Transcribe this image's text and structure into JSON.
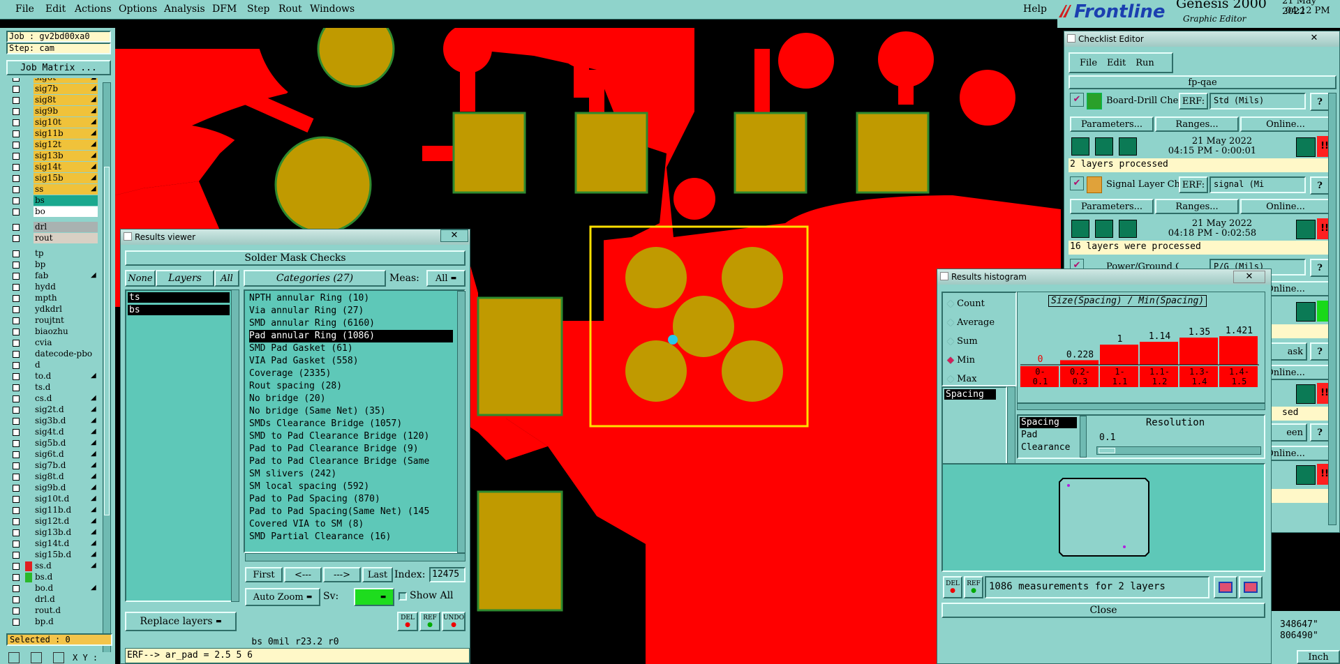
{
  "menubar": {
    "items": [
      "File",
      "Edit",
      "Actions",
      "Options",
      "Analysis",
      "DFM",
      "Step",
      "Rout",
      "Windows"
    ],
    "help": "Help"
  },
  "brand": {
    "logo": "Frontline",
    "product": "Genesis 2000",
    "subtitle": "Graphic Editor",
    "date": "21 May 2022",
    "time": "04:12 PM"
  },
  "job": {
    "job_label": "Job : gv2bd00xa0",
    "step_label": "Step: cam",
    "job_matrix": "Job Matrix ..."
  },
  "layers": [
    {
      "name": "sig6t",
      "color": "#f0c23a",
      "arrow": true
    },
    {
      "name": "sig7b",
      "color": "#f0c23a",
      "arrow": true
    },
    {
      "name": "sig8t",
      "color": "#f0c23a",
      "arrow": true
    },
    {
      "name": "sig9b",
      "color": "#f0c23a",
      "arrow": true
    },
    {
      "name": "sig10t",
      "color": "#f0c23a",
      "arrow": true
    },
    {
      "name": "sig11b",
      "color": "#f0c23a",
      "arrow": true
    },
    {
      "name": "sig12t",
      "color": "#f0c23a",
      "arrow": true
    },
    {
      "name": "sig13b",
      "color": "#f0c23a",
      "arrow": true
    },
    {
      "name": "sig14t",
      "color": "#f0c23a",
      "arrow": true
    },
    {
      "name": "sig15b",
      "color": "#f0c23a",
      "arrow": true
    },
    {
      "name": "ss",
      "color": "#f0c23a",
      "arrow": true
    },
    {
      "name": "bs",
      "color": "#1aa88e",
      "arrow": false
    },
    {
      "name": "bo",
      "color": "#ffffff",
      "arrow": false
    },
    {
      "name": "drl",
      "color": "#a9b2b1",
      "arrow": false
    },
    {
      "name": "rout",
      "color": "#d8d0c4",
      "arrow": false
    },
    {
      "name": "tp",
      "color": "#8fd3cb",
      "arrow": false
    },
    {
      "name": "bp",
      "color": "#8fd3cb",
      "arrow": false
    },
    {
      "name": "fab",
      "color": "#8fd3cb",
      "arrow": true
    },
    {
      "name": "hydd",
      "color": "#8fd3cb",
      "arrow": false
    },
    {
      "name": "mpth",
      "color": "#8fd3cb",
      "arrow": false
    },
    {
      "name": "ydkdrl",
      "color": "#8fd3cb",
      "arrow": false
    },
    {
      "name": "roujtnt",
      "color": "#8fd3cb",
      "arrow": false
    },
    {
      "name": "biaozhu",
      "color": "#8fd3cb",
      "arrow": false
    },
    {
      "name": "cvia",
      "color": "#8fd3cb",
      "arrow": false
    },
    {
      "name": "datecode-pbo",
      "color": "#8fd3cb",
      "arrow": false
    },
    {
      "name": "d",
      "color": "#8fd3cb",
      "arrow": false
    },
    {
      "name": "to.d",
      "color": "#8fd3cb",
      "arrow": true
    },
    {
      "name": "ts.d",
      "color": "#8fd3cb",
      "arrow": false
    },
    {
      "name": "cs.d",
      "color": "#8fd3cb",
      "arrow": true
    },
    {
      "name": "sig2t.d",
      "color": "#8fd3cb",
      "arrow": true
    },
    {
      "name": "sig3b.d",
      "color": "#8fd3cb",
      "arrow": true
    },
    {
      "name": "sig4t.d",
      "color": "#8fd3cb",
      "arrow": true
    },
    {
      "name": "sig5b.d",
      "color": "#8fd3cb",
      "arrow": true
    },
    {
      "name": "sig6t.d",
      "color": "#8fd3cb",
      "arrow": true
    },
    {
      "name": "sig7b.d",
      "color": "#8fd3cb",
      "arrow": true
    },
    {
      "name": "sig8t.d",
      "color": "#8fd3cb",
      "arrow": true
    },
    {
      "name": "sig9b.d",
      "color": "#8fd3cb",
      "arrow": true
    },
    {
      "name": "sig10t.d",
      "color": "#8fd3cb",
      "arrow": true
    },
    {
      "name": "sig11b.d",
      "color": "#8fd3cb",
      "arrow": true
    },
    {
      "name": "sig12t.d",
      "color": "#8fd3cb",
      "arrow": true
    },
    {
      "name": "sig13b.d",
      "color": "#8fd3cb",
      "arrow": true
    },
    {
      "name": "sig14t.d",
      "color": "#8fd3cb",
      "arrow": true
    },
    {
      "name": "sig15b.d",
      "color": "#8fd3cb",
      "arrow": true
    },
    {
      "name": "ss.d",
      "color": "#8fd3cb",
      "arrow": true
    },
    {
      "name": "bs.d",
      "color": "#8fd3cb",
      "arrow": false
    },
    {
      "name": "bo.d",
      "color": "#8fd3cb",
      "arrow": true
    },
    {
      "name": "drl.d",
      "color": "#8fd3cb",
      "arrow": false
    },
    {
      "name": "rout.d",
      "color": "#8fd3cb",
      "arrow": false
    },
    {
      "name": "bp.d",
      "color": "#8fd3cb",
      "arrow": false
    }
  ],
  "selected": "Selected : 0",
  "results_viewer": {
    "title": "Results viewer",
    "header": "Solder Mask Checks",
    "none": "None",
    "layers_label": "Layers",
    "all": "All",
    "layer_items": [
      "ts",
      "bs"
    ],
    "categories_label": "Categories (27)",
    "meas_label": "Meas:",
    "meas_value": "All",
    "categories": [
      "NPTH annular Ring (10)",
      "Via annular Ring (27)",
      "SMD annular Ring (6160)",
      "Pad annular Ring (1086)",
      "SMD Pad Gasket (61)",
      "VIA Pad Gasket (558)",
      "Coverage (2335)",
      "Rout spacing (28)",
      "No bridge (20)",
      "No bridge (Same Net) (35)",
      "SMDs Clearance Bridge (1057)",
      "SMD to Pad Clearance Bridge (120)",
      "Pad to Pad Clearance Bridge (9)",
      "Pad to Pad Clearance Bridge (Same",
      "SM slivers (242)",
      "SM local spacing (592)",
      "Pad to Pad Spacing (870)",
      "Pad to Pad Spacing(Same Net) (145",
      "Covered VIA to SM (8)",
      "SMD Partial Clearance (16)"
    ],
    "selected_index": 3,
    "first": "First",
    "prev": "<---",
    "next": "--->",
    "last": "Last",
    "index_label": "Index:",
    "index_value": "12475",
    "auto_zoom": "Auto Zoom",
    "sv_label": "Sv:",
    "show_all": "Show All",
    "replace_layers": "Replace layers",
    "del": "DEL",
    "ref": "REF",
    "undo": "UNDO",
    "status": "bs 0mil  r23.2  r0"
  },
  "erf_line": "ERF--> ar_pad = 2.5 5 6",
  "checklist": {
    "title": "Checklist Editor",
    "menu": [
      "File",
      "Edit",
      "Run"
    ],
    "name": "fp-qae",
    "erf_label": "ERF:",
    "parameters": "Parameters...",
    "ranges": "Ranges...",
    "online": "Online...",
    "checks": [
      {
        "name": "Board-Drill Che",
        "erf": "Std (Mils)",
        "date": "21 May 2022",
        "time": "04:15 PM - 0:00:01",
        "status": "2 layers processed"
      },
      {
        "name": "Signal Layer Ch",
        "erf": "signal (Mi",
        "date": "21 May 2022",
        "time": "04:18 PM - 0:02:58",
        "status": "16 layers were processed"
      },
      {
        "name": "Power/Ground C",
        "erf": "P/G (Mils)"
      }
    ],
    "partial_texts": [
      "ask",
      "sed",
      "een"
    ]
  },
  "histogram": {
    "title": "Results histogram",
    "modes": [
      "Count",
      "Average",
      "Sum",
      "Min",
      "Max"
    ],
    "selected_mode": "Min",
    "measure_item": "Spacing",
    "chart_title": "Size(Spacing) / Min(Spacing)",
    "bins": [
      "0-0.1",
      "0.2-0.3",
      "1-1.1",
      "1.1-1.2",
      "1.3-1.4",
      "1.4-1.5"
    ],
    "bin_line1": [
      "0-",
      "0.2-",
      "1-",
      "1.1-",
      "1.3-",
      "1.4-"
    ],
    "bin_line2": [
      "0.1",
      "0.3",
      "1.1",
      "1.2",
      "1.4",
      "1.5"
    ],
    "values": [
      0,
      0.228,
      1,
      1.14,
      1.35,
      1.421
    ],
    "value_labels": [
      "0",
      "0.228",
      "1",
      "1.14",
      "1.35",
      "1.421"
    ],
    "measure_list": [
      "Spacing",
      "Pad",
      "Clearance"
    ],
    "resolution_label": "Resolution",
    "resolution_value": "0.1",
    "summary": "1086 measurements for 2 layers",
    "close": "Close",
    "del": "DEL",
    "ref": "REF"
  },
  "coords": {
    "x": "348647\"",
    "y": "806490\"",
    "units": "Inch"
  },
  "footer": {
    "xy_label": "X Y :"
  }
}
